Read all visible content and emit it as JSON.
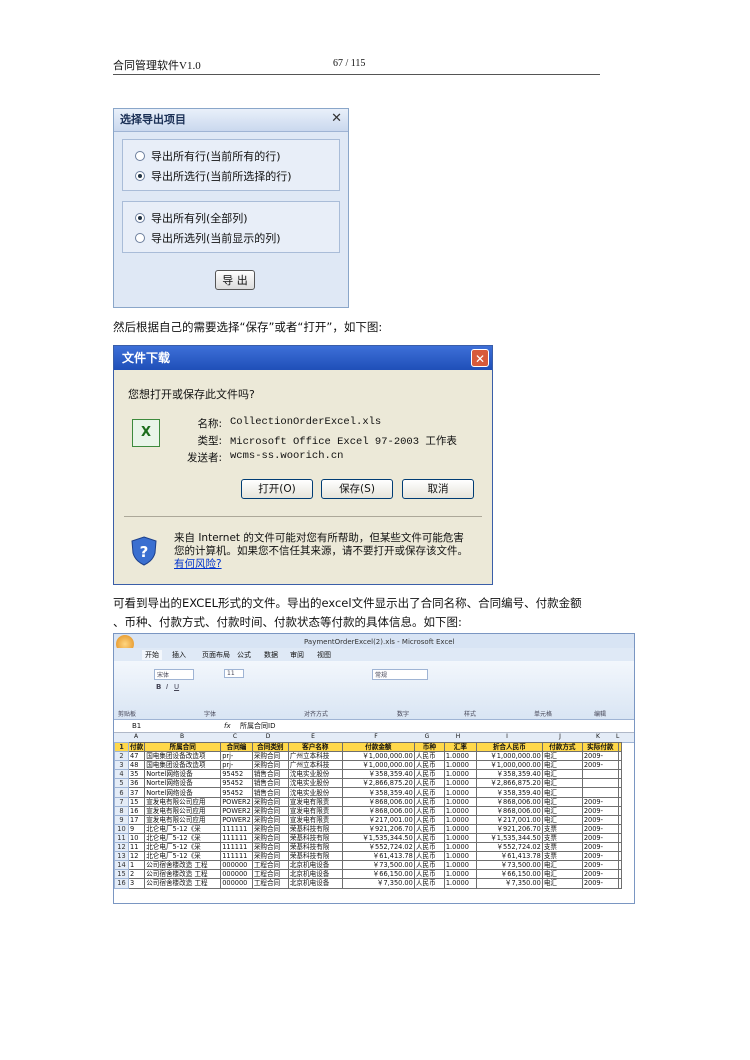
{
  "header": {
    "title": "合同管理软件V1.0",
    "page": "67 / 115"
  },
  "dialog1": {
    "title": "选择导出项目",
    "close": "✕",
    "rows_options": [
      "导出所有行(当前所有的行)",
      "导出所选行(当前所选择的行)"
    ],
    "rows_selected": 1,
    "cols_options": [
      "导出所有列(全部列)",
      "导出所选列(当前显示的列)"
    ],
    "cols_selected": 0,
    "button": "导 出"
  },
  "para1": "然后根据自己的需要选择“保存”或者“打开”，如下图:",
  "dialog2": {
    "title": "文件下载",
    "question": "您想打开或保存此文件吗?",
    "name_label": "名称:",
    "name_value": "CollectionOrderExcel.xls",
    "type_label": "类型:",
    "type_value": "Microsoft Office Excel 97-2003 工作表",
    "from_label": "发送者:",
    "from_value": "wcms-ss.woorich.cn",
    "open_button": "打开(O)",
    "save_button": "保存(S)",
    "cancel_button": "取消",
    "warning": "来自 Internet 的文件可能对您有所帮助，但某些文件可能危害您的计算机。如果您不信任其来源，请不要打开或保存该文件。",
    "risk_link": "有何风险?"
  },
  "para2_line1": "可看到导出的EXCEL形式的文件。导出的excel文件显示出了合同名称、合同编号、付款金额",
  "para2_line2": "、币种、付款方式、付款时间、付款状态等付款的具体信息。如下图:",
  "excel": {
    "filename": "PaymentOrderExcel(2).xls - Microsoft Excel",
    "tabs": [
      "开始",
      "插入",
      "页面布局",
      "公式",
      "数据",
      "审阅",
      "视图"
    ],
    "groups": [
      "剪贴板",
      "字体",
      "对齐方式",
      "数字",
      "样式",
      "单元格",
      "编辑"
    ],
    "font_name": "宋体",
    "font_size": "11",
    "number_format": "常规",
    "cell_ref": "B1",
    "formula": "所属合同ID",
    "columns": [
      "A",
      "B",
      "C",
      "D",
      "E",
      "F",
      "G",
      "H",
      "I",
      "J",
      "K",
      "L"
    ],
    "headers": [
      "付款",
      "所属合同",
      "合同编",
      "合同类别",
      "客户名称",
      "付款金额",
      "币种",
      "汇率",
      "折合人民币",
      "付款方式",
      "实际付款"
    ],
    "rows": [
      [
        "47",
        "国电集团设备改造项",
        "prj-",
        "采购合同",
        "广州立本科技",
        "￥1,000,000.00",
        "人民币",
        "1.0000",
        "￥1,000,000.00",
        "电汇",
        "2009-"
      ],
      [
        "48",
        "国电集团设备改造项",
        "prj-",
        "采购合同",
        "广州立本科技",
        "￥1,000,000.00",
        "人民币",
        "1.0000",
        "￥1,000,000.00",
        "电汇",
        "2009-"
      ],
      [
        "35",
        "Nortel网络设备",
        "95452",
        "销售合同",
        "沈电实业股份",
        "￥358,359.40",
        "人民币",
        "1.0000",
        "￥358,359.40",
        "电汇",
        ""
      ],
      [
        "36",
        "Nortel网络设备",
        "95452",
        "销售合同",
        "沈电实业股份",
        "￥2,866,875.20",
        "人民币",
        "1.0000",
        "￥2,866,875.20",
        "电汇",
        ""
      ],
      [
        "37",
        "Nortel网络设备",
        "95452",
        "销售合同",
        "沈电实业股份",
        "￥358,359.40",
        "人民币",
        "1.0000",
        "￥358,359.40",
        "电汇",
        ""
      ],
      [
        "15",
        "宣发电有限公司应用",
        "POWER2",
        "采购合同",
        "宣发电有限责",
        "￥868,006.00",
        "人民币",
        "1.0000",
        "￥868,006.00",
        "电汇",
        "2009-"
      ],
      [
        "16",
        "宣发电有限公司应用",
        "POWER2",
        "采购合同",
        "宣发电有限责",
        "￥868,006.00",
        "人民币",
        "1.0000",
        "￥868,006.00",
        "电汇",
        "2009-"
      ],
      [
        "17",
        "宣发电有限公司应用",
        "POWER2",
        "采购合同",
        "宣发电有限责",
        "￥217,001.00",
        "人民币",
        "1.0000",
        "￥217,001.00",
        "电汇",
        "2009-"
      ],
      [
        "9",
        "北仑电厂5-12《采",
        "111111",
        "采购合同",
        "荣基科技有限",
        "￥921,206.70",
        "人民币",
        "1.0000",
        "￥921,206.70",
        "支票",
        "2009-"
      ],
      [
        "10",
        "北仑电厂5-12《采",
        "111111",
        "采购合同",
        "荣基科技有限",
        "￥1,535,344.50",
        "人民币",
        "1.0000",
        "￥1,535,344.50",
        "支票",
        "2009-"
      ],
      [
        "11",
        "北仑电厂5-12《采",
        "111111",
        "采购合同",
        "荣基科技有限",
        "￥552,724.02",
        "人民币",
        "1.0000",
        "￥552,724.02",
        "支票",
        "2009-"
      ],
      [
        "12",
        "北仑电厂5-12《采",
        "111111",
        "采购合同",
        "荣基科技有限",
        "￥61,413.78",
        "人民币",
        "1.0000",
        "￥61,413.78",
        "支票",
        "2009-"
      ],
      [
        "1",
        "公司宿舍楼改造 工程",
        "000000",
        "工程合同",
        "北京机电设备",
        "￥73,500.00",
        "人民币",
        "1.0000",
        "￥73,500.00",
        "电汇",
        "2009-"
      ],
      [
        "2",
        "公司宿舍楼改造 工程",
        "000000",
        "工程合同",
        "北京机电设备",
        "￥66,150.00",
        "人民币",
        "1.0000",
        "￥66,150.00",
        "电汇",
        "2009-"
      ],
      [
        "3",
        "公司宿舍楼改造 工程",
        "000000",
        "工程合同",
        "北京机电设备",
        "￥7,350.00",
        "人民币",
        "1.0000",
        "￥7,350.00",
        "电汇",
        "2009-"
      ]
    ]
  }
}
